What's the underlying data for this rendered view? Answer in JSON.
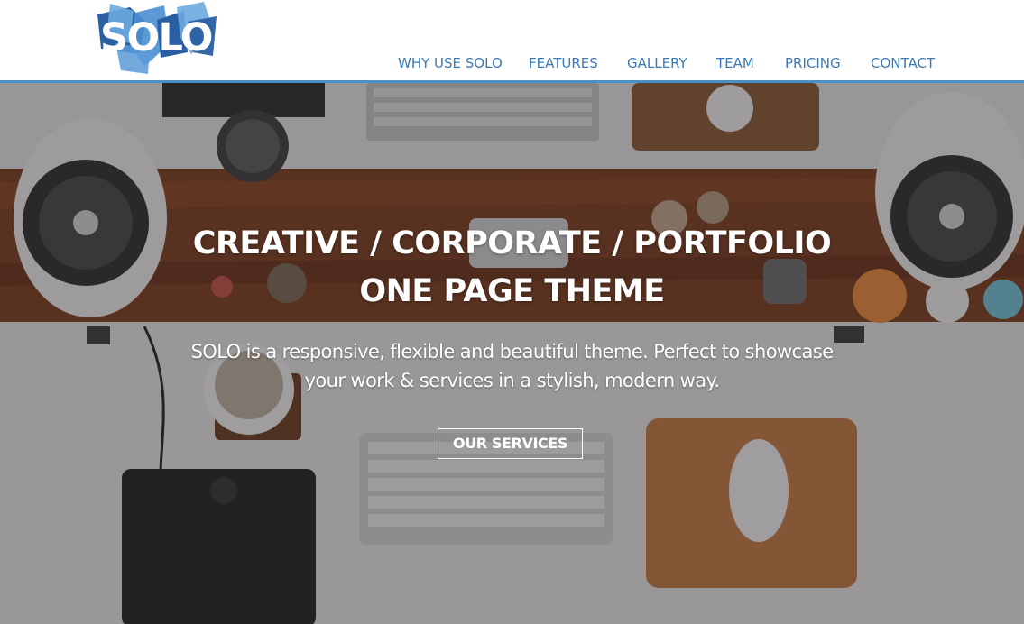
{
  "brand": {
    "logo_text": "SOLO",
    "accent": "#4a90c8",
    "logo_dark": "#2a5fa2",
    "logo_light": "#6aaae0"
  },
  "nav": {
    "items": [
      {
        "label": "WHY USE SOLO"
      },
      {
        "label": "FEATURES"
      },
      {
        "label": "GALLERY"
      },
      {
        "label": "TEAM"
      },
      {
        "label": "PRICING"
      },
      {
        "label": "CONTACT"
      }
    ],
    "color": "#3a7ab8"
  },
  "hero": {
    "title_line1": "CREATIVE / CORPORATE / PORTFOLIO",
    "title_line2": "ONE PAGE THEME",
    "subtitle_line1": "SOLO is a responsive, flexible and beautiful theme. Perfect to showcase",
    "subtitle_line2": "your work & services in a stylish, modern way.",
    "cta_label": "OUR SERVICES",
    "background_icon": "desk-workspace-photo"
  }
}
